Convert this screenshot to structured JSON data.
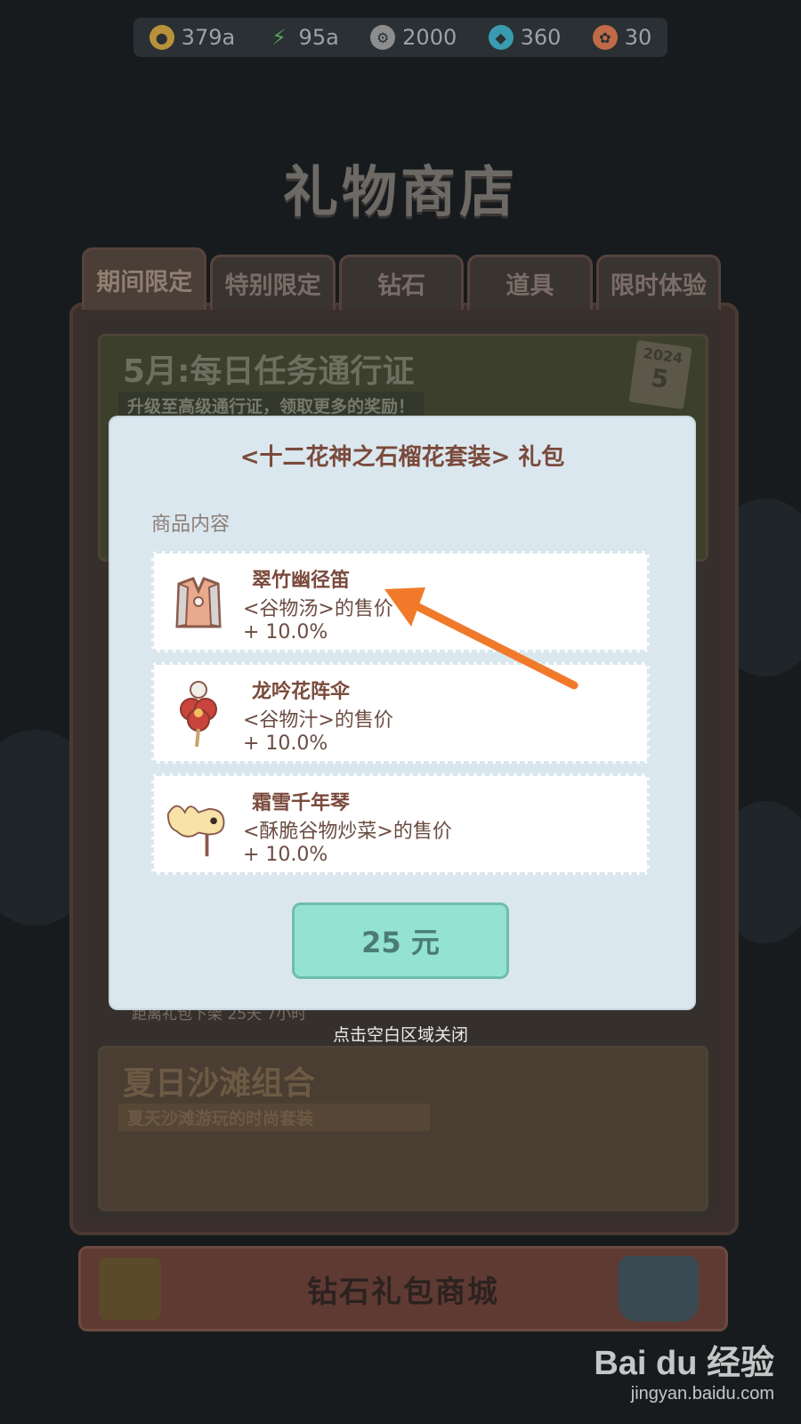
{
  "currency": [
    {
      "icon": "gold-coin-icon",
      "value": "379a",
      "color": "#b8923a"
    },
    {
      "icon": "lightning-icon",
      "value": "95a",
      "color": "#58a45a"
    },
    {
      "icon": "gear-token-icon",
      "value": "2000",
      "color": "#8d8d8d"
    },
    {
      "icon": "diamond-icon",
      "value": "360",
      "color": "#3a9bb0"
    },
    {
      "icon": "ticket-icon",
      "value": "30",
      "color": "#c06a48"
    }
  ],
  "shop": {
    "title": "礼物商店",
    "tabs": [
      {
        "label": "期间限定",
        "active": true
      },
      {
        "label": "特别限定",
        "active": false
      },
      {
        "label": "钻石",
        "active": false
      },
      {
        "label": "道具",
        "active": false
      },
      {
        "label": "限时体验",
        "active": false
      }
    ],
    "banner_pass": {
      "title": "5月:每日任务通行证",
      "subtitle": "升级至高级通行证，领取更多的奖励！",
      "year": "2024",
      "day": "5"
    },
    "under_modal_text": "距离礼包下架 25天 7小时",
    "banner_beach": {
      "title": "夏日沙滩组合",
      "subtitle": "夏天沙滩游玩的时尚套装"
    },
    "diamond_shop_label": "钻石礼包商城"
  },
  "modal": {
    "title": "<十二花神之石榴花套装> 礼包",
    "section_label": "商品内容",
    "items": [
      {
        "name": "翠竹幽径笛",
        "desc": "<谷物汤>的售价",
        "bonus": "+ 10.0%",
        "icon": "vest-icon"
      },
      {
        "name": "龙吟花阵伞",
        "desc": "<谷物汁>的售价",
        "bonus": "+ 10.0%",
        "icon": "flower-umbrella-icon"
      },
      {
        "name": "霜雪千年琴",
        "desc": "<酥脆谷物炒菜>的售价",
        "bonus": "+ 10.0%",
        "icon": "goldfish-lantern-icon"
      }
    ],
    "price": "25 元",
    "close_hint": "点击空白区域关闭"
  },
  "watermark": {
    "logo": "Bai du 经验",
    "url": "jingyan.baidu.com"
  },
  "annotation_color": "#f07a2a"
}
